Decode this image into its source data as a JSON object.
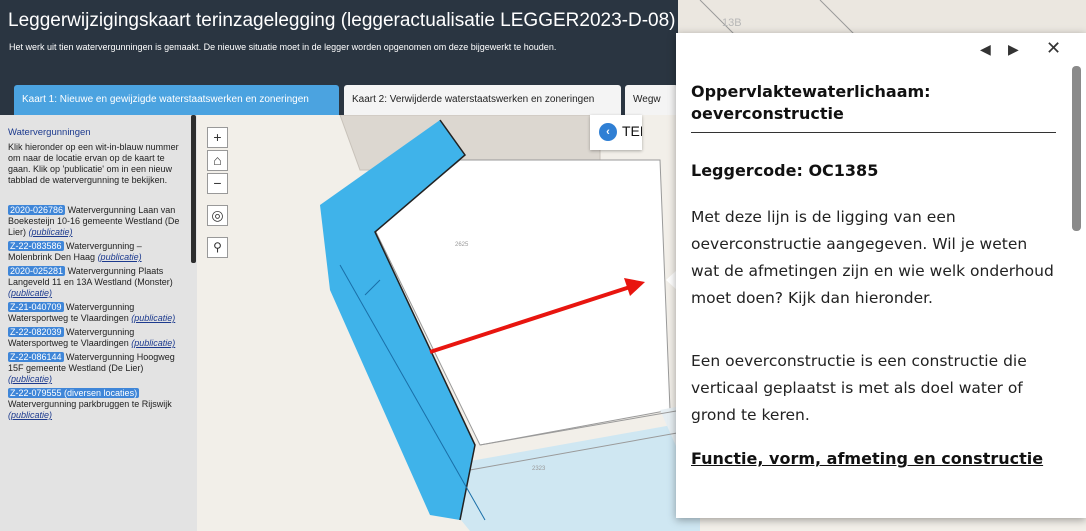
{
  "header": {
    "title": "Leggerwijzigingskaart terinzagelegging (leggeractualisatie LEGGER2023-D-08)",
    "description": "Het werk uit tien watervergunningen is gemaakt. De nieuwe situatie moet in de legger worden opgenomen om deze bijgewerkt te houden."
  },
  "tabs": [
    {
      "label": "Kaart 1: Nieuwe en gewijzigde waterstaatswerken en zoneringen",
      "active": true
    },
    {
      "label": "Kaart 2: Verwijderde waterstaatswerken en zoneringen",
      "active": false
    },
    {
      "label": "Wegw",
      "active": false
    }
  ],
  "sidebar": {
    "title": "Watervergunningen",
    "help": "Klik hieronder op een wit-in-blauw nummer om naar de locatie ervan op de kaart te gaan. Klik op 'publicatie' om in een nieuw tabblad de watervergunning te bekijken.",
    "items": [
      {
        "code": "2020-026786",
        "text": " Watervergunning Laan van Boekesteijn 10-16 gemeente Westland (De Lier) ",
        "link": "(publicatie)"
      },
      {
        "code": "Z-22-083586",
        "text": " Watervergunning – Molenbrink Den Haag ",
        "link": "(publicatie)"
      },
      {
        "code": "2020-025281",
        "text": " Watervergunning Plaats Langeveld 11 en 13A Westland (Monster) ",
        "link": "(publicatie)"
      },
      {
        "code": "Z-21-040709",
        "text": " Watervergunning Watersportweg te Vlaardingen ",
        "link": "(publicatie)"
      },
      {
        "code": "Z-22-082039",
        "text": " Watervergunning Watersportweg te Vlaardingen ",
        "link": "(publicatie)"
      },
      {
        "code": "Z-22-086144",
        "text": " Watervergunning Hoogweg 15F gemeente Westland (De Lier) ",
        "link": "(publicatie)"
      },
      {
        "code": "Z-22-079555 (diversen locaties)",
        "text": " Watervergunning parkbruggen te Rijswijk ",
        "link": "(publicatie)"
      }
    ]
  },
  "map": {
    "labels": {
      "top": "13B",
      "mid": "2625",
      "bottom": "2323"
    },
    "back_label": "TERU",
    "back_icon": "chevron-left-icon",
    "colors": {
      "water": "#3fb3ea",
      "arrow": "#e8150f",
      "parcel": "#ffffff",
      "background": "#f2efe9"
    }
  },
  "controls": {
    "zoom_in": "+",
    "home": "⌂",
    "zoom_out": "−",
    "locate": "◎",
    "search": "⚲"
  },
  "popup": {
    "prev": "◀",
    "next": "▶",
    "close": "✕",
    "title": "Oppervlaktewaterlichaam: oeverconstructie",
    "leggercode": "Leggercode: OC1385",
    "para1": "Met deze lijn is de ligging van een oeverconstructie aangegeven. Wil je weten wat de afmetingen zijn en wie welk onderhoud moet doen? Kijk dan hieronder.",
    "para2": "Een oeverconstructie is een constructie die verticaal geplaatst is met als doel water of grond te keren.",
    "section_link": "Functie, vorm, afmeting en constructie"
  }
}
